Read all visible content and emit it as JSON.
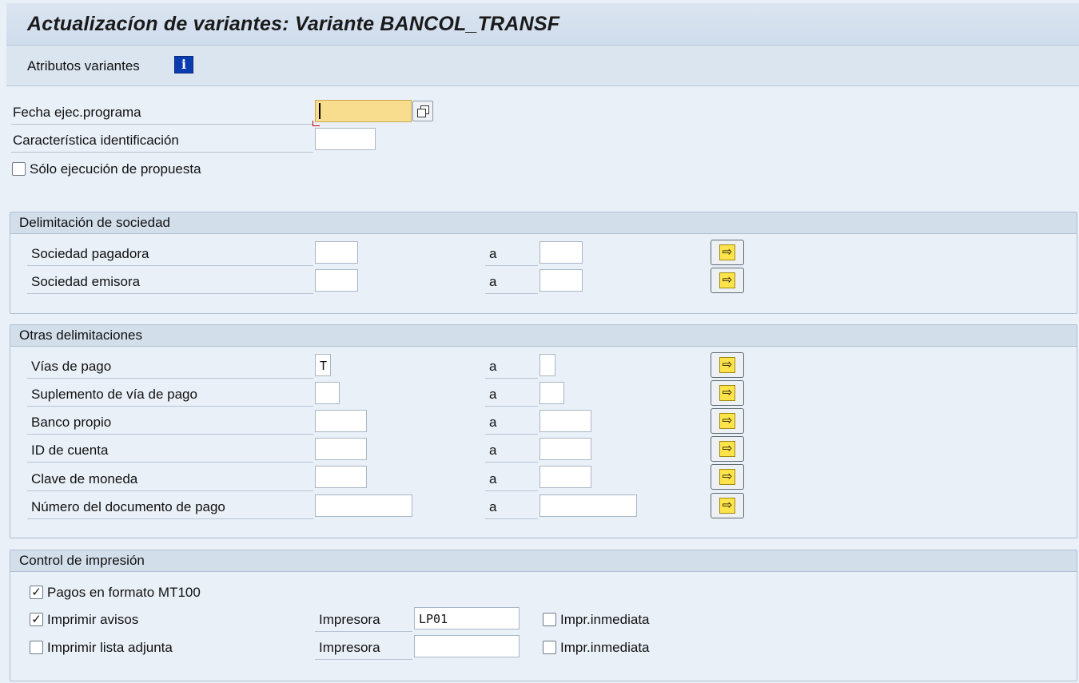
{
  "window": {
    "title": "Actualizacíon de variantes: Variante BANCOL_TRANSF"
  },
  "toolbar": {
    "attributes_label": "Atributos variantes",
    "info_icon": "info-icon",
    "info_glyph": "i"
  },
  "params": {
    "run_date_label": "Fecha ejec.programa",
    "run_date_value": "",
    "identification_label": "Característica identificación",
    "identification_value": "",
    "proposal_only_label": "Sólo ejecución de propuesta",
    "proposal_only_checked": false
  },
  "range_to_label": "a",
  "multiple_selection_icon": "arrow-right-icon",
  "multiple_selection_glyph": "⇨",
  "company": {
    "title": "Delimitación de sociedad",
    "rows": [
      {
        "label": "Sociedad pagadora",
        "from": "",
        "to": ""
      },
      {
        "label": "Sociedad emisora",
        "from": "",
        "to": ""
      }
    ]
  },
  "other": {
    "title": "Otras delimitaciones",
    "rows": [
      {
        "label": "Vías de pago",
        "from": "T",
        "to": ""
      },
      {
        "label": "Suplemento de vía de pago",
        "from": "",
        "to": ""
      },
      {
        "label": "Banco propio",
        "from": "",
        "to": ""
      },
      {
        "label": "ID de cuenta",
        "from": "",
        "to": ""
      },
      {
        "label": "Clave de moneda",
        "from": "",
        "to": ""
      },
      {
        "label": "Número del documento de pago",
        "from": "",
        "to": ""
      }
    ]
  },
  "print": {
    "title": "Control de impresión",
    "mt100_label": "Pagos en formato MT100",
    "mt100_checked": true,
    "print_notices_label": "Imprimir avisos",
    "print_notices_checked": true,
    "printer_label": "Impresora",
    "printer_value": "LP01",
    "immediate_label": "Impr.inmediata",
    "immediate_checked": false,
    "print_list_label": "Imprimir lista adjunta",
    "print_list_checked": false,
    "printer2_label": "Impresora",
    "printer2_value": "",
    "immediate2_label": "Impr.inmediata",
    "immediate2_checked": false
  },
  "check_glyph": "✓"
}
